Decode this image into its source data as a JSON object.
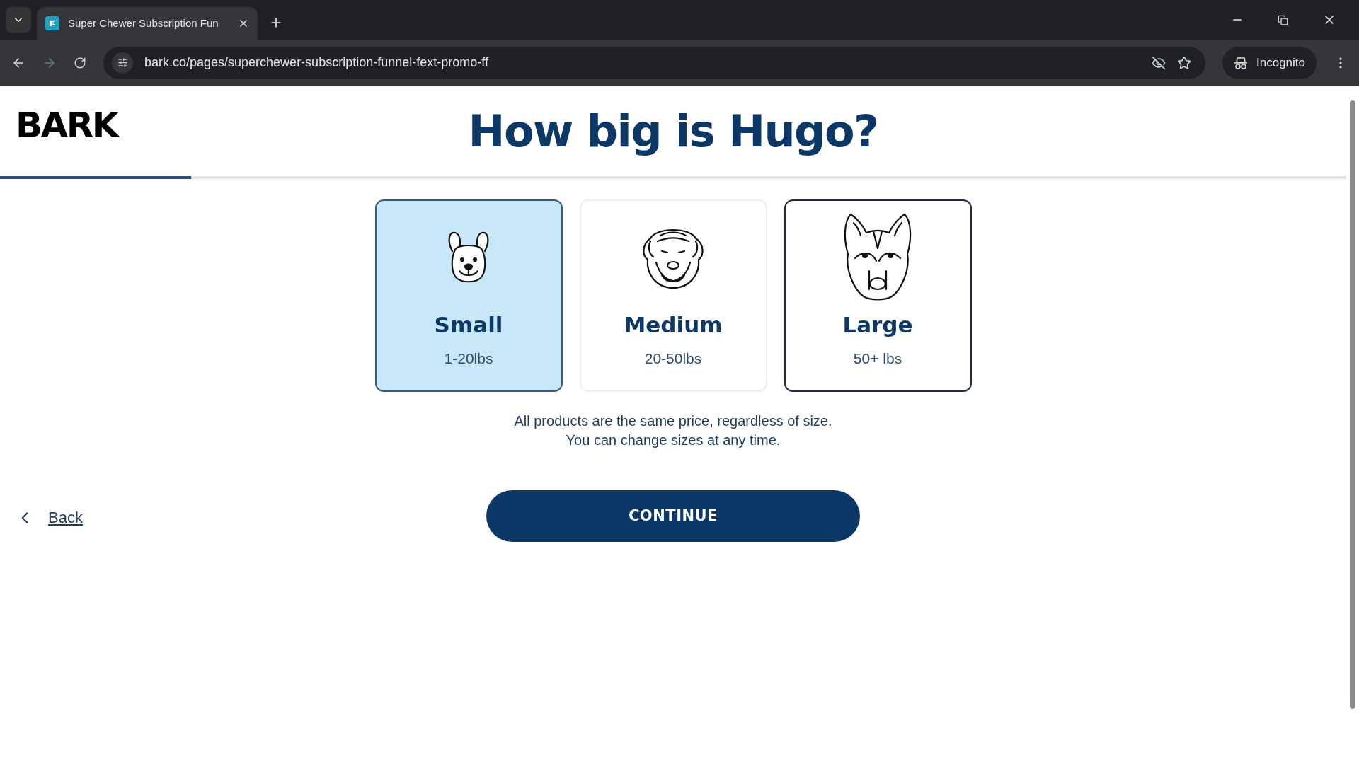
{
  "browser": {
    "tab": {
      "title": "Super Chewer Subscription Fun"
    },
    "url": "bark.co/pages/superchewer-subscription-funnel-fext-promo-ff",
    "profile": "Incognito"
  },
  "page": {
    "logo": "BARK",
    "title": "How big is Hugo?",
    "progress": {
      "level": 0.142
    },
    "sizes": [
      {
        "kind": "bulldog",
        "label": "Small",
        "weight": "1-20lbs",
        "selected": true,
        "hovered": false
      },
      {
        "kind": "sharpei",
        "label": "Medium",
        "weight": "20-50lbs",
        "selected": false,
        "hovered": false
      },
      {
        "kind": "husky",
        "label": "Large",
        "weight": "50+ lbs",
        "selected": false,
        "hovered": true
      }
    ],
    "note": [
      "All products are the same price, regardless of size.",
      "You can change sizes at any time."
    ],
    "continue": "CONTINUE",
    "back": "Back"
  }
}
